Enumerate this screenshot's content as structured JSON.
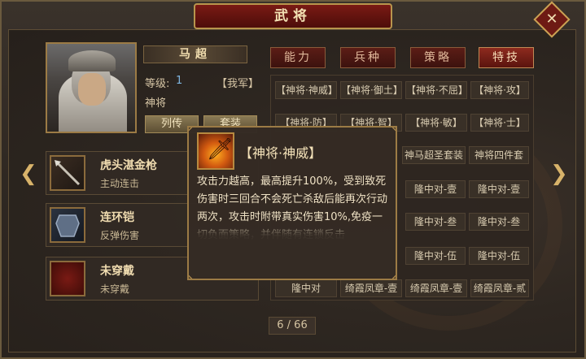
{
  "header": {
    "title": "武将"
  },
  "hero": {
    "name": "马超",
    "level_label": "等级:",
    "level_value": "1",
    "faction": "【我军】",
    "rank": "神将",
    "btn_biography": "列传",
    "btn_set": "套装"
  },
  "equipment": [
    {
      "name": "虎头湛金枪",
      "effect": "主动连击"
    },
    {
      "name": "连环铠",
      "effect": "反弹伤害"
    },
    {
      "name": "未穿戴",
      "effect": "未穿戴"
    }
  ],
  "tabs": [
    {
      "label": "能力",
      "active": false
    },
    {
      "label": "兵种",
      "active": false
    },
    {
      "label": "策略",
      "active": false
    },
    {
      "label": "特技",
      "active": true
    }
  ],
  "skills": {
    "row1": [
      "【神将·神威】",
      "【神将·御土】",
      "【神将·不屈】",
      "【神将·攻】"
    ],
    "row2": [
      "【神将·防】",
      "【神将·智】",
      "【神将·敏】",
      "【神将·士】"
    ],
    "row3": [
      "神马超圣套装",
      "神将四件套"
    ],
    "row4": [
      "隆中对-壹",
      "隆中对-壹"
    ],
    "row5": [
      "隆中对-叁",
      "隆中对-叁"
    ],
    "row6": [
      "隆中对-伍",
      "隆中对-伍"
    ],
    "row7": [
      "隆中对",
      "绮霞凤章-壹",
      "绮霞凤章-壹",
      "绮霞凤章-贰"
    ]
  },
  "tooltip": {
    "title": "【神将·神威】",
    "description": "攻击力越高，最高提升100%，受到致死伤害时三回合不会死亡杀敌后能再次行动两次，攻击时附带真实伤害10%,免疫一切负面策略，并伴随有连锁反击"
  },
  "pagination": {
    "text": "6 / 66"
  },
  "colors": {
    "accent_red": "#7a1a14",
    "gold_border": "#b8954d",
    "text_light": "#f0dcb0"
  }
}
